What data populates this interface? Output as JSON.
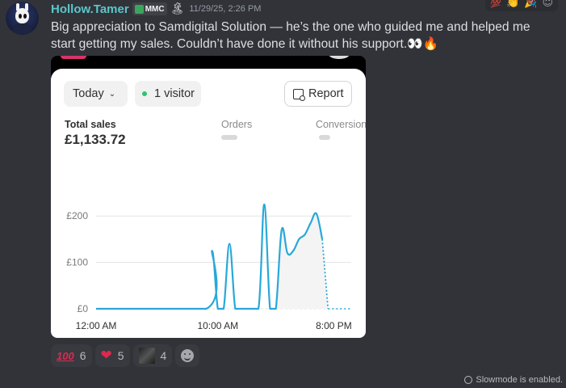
{
  "message": {
    "username": "Hollow.Tamer",
    "tag": "MMC",
    "timestamp": "11/29/25, 2:26 PM",
    "text": "Big appreciation to Samdigital Solution — he’s the one who guided me and helped me start getting my sales. Couldn’t have done it without his support.👀🔥"
  },
  "attachment": {
    "today_label": "Today",
    "visitor_label": "1 visitor",
    "report_label": "Report",
    "total_sales_label": "Total sales",
    "total_sales_value": "£1,133.72",
    "orders_label": "Orders",
    "conversion_label": "Conversion"
  },
  "chart_data": {
    "type": "line",
    "y_tick_labels": [
      "£200",
      "£100",
      "£0"
    ],
    "y_ticks": [
      200,
      100,
      0
    ],
    "x_tick_labels": [
      "12:00 AM",
      "10:00 AM",
      "8:00 PM"
    ],
    "ylim": [
      0,
      230
    ],
    "x_hours": [
      0,
      9.5,
      10,
      10.5,
      11,
      11.5,
      12,
      12.5,
      13,
      14,
      14.5,
      15,
      15.5,
      16,
      16.5,
      17,
      17.5,
      18,
      18.5,
      19,
      19.5,
      20
    ],
    "values": [
      0,
      0,
      125,
      0,
      0,
      140,
      0,
      0,
      0,
      0,
      225,
      0,
      0,
      170,
      120,
      125,
      150,
      160,
      185,
      205,
      150,
      0
    ],
    "projected_after_hour": 19.5,
    "line_color": "#28a8d9"
  },
  "reactions": [
    {
      "emoji": "💯",
      "count": "6"
    },
    {
      "emoji": "❤",
      "count": "5"
    },
    {
      "emoji": "photo",
      "count": "4"
    }
  ],
  "top_reactions": [
    "💯",
    "👏",
    "🎉",
    "😀"
  ],
  "footer": {
    "slowmode_text": "Slowmode is enabled."
  }
}
